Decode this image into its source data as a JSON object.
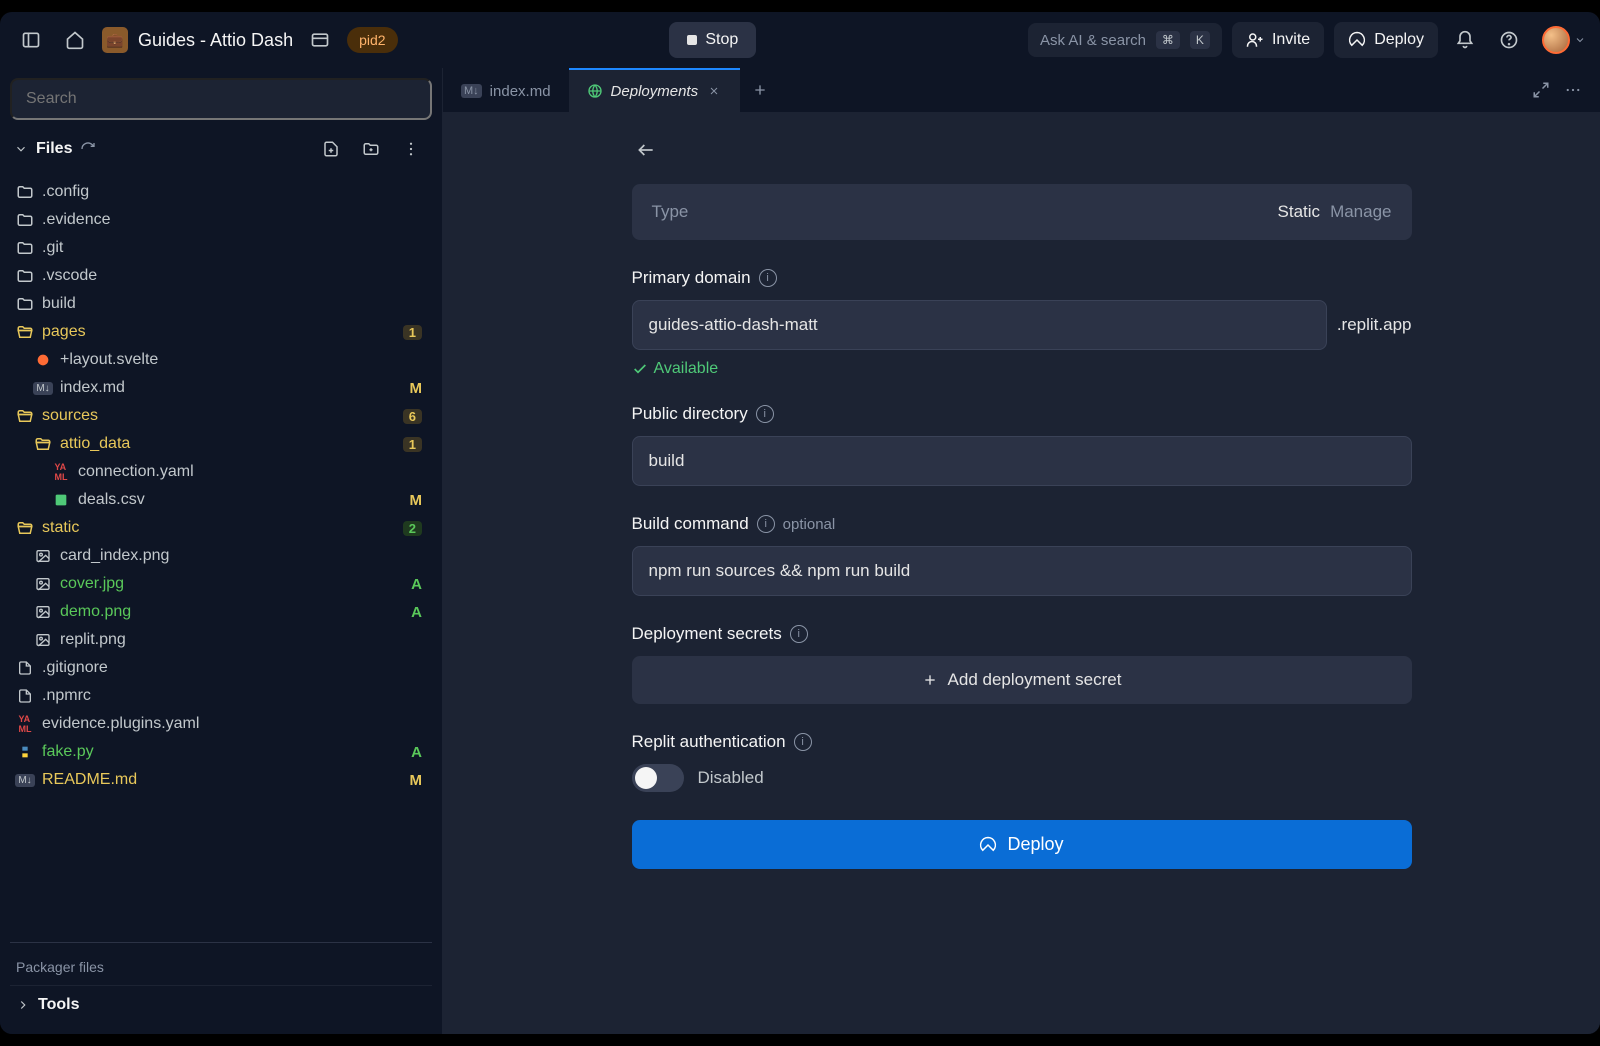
{
  "topbar": {
    "project_title": "Guides - Attio Dash",
    "project_emoji": "💼",
    "pid_label": "pid2",
    "stop_label": "Stop",
    "search_placeholder": "Ask AI & search",
    "search_kbd1": "⌘",
    "search_kbd2": "K",
    "invite_label": "Invite",
    "deploy_label": "Deploy"
  },
  "sidebar": {
    "search_placeholder": "Search",
    "files_label": "Files",
    "packager_label": "Packager files",
    "tools_label": "Tools",
    "tree": [
      {
        "kind": "folder",
        "name": ".config",
        "indent": 0
      },
      {
        "kind": "folder",
        "name": ".evidence",
        "indent": 0
      },
      {
        "kind": "folder",
        "name": ".git",
        "indent": 0
      },
      {
        "kind": "folder",
        "name": ".vscode",
        "indent": 0
      },
      {
        "kind": "folder",
        "name": "build",
        "indent": 0
      },
      {
        "kind": "folder-open",
        "name": "pages",
        "indent": 0,
        "color": "yellow",
        "badge": "1"
      },
      {
        "kind": "svelte",
        "name": "+layout.svelte",
        "indent": 1
      },
      {
        "kind": "md",
        "name": "index.md",
        "indent": 1,
        "status": "M"
      },
      {
        "kind": "folder-open",
        "name": "sources",
        "indent": 0,
        "color": "yellow",
        "badge": "6"
      },
      {
        "kind": "folder-open",
        "name": "attio_data",
        "indent": 1,
        "color": "yellow",
        "badge": "1"
      },
      {
        "kind": "yaml",
        "name": "connection.yaml",
        "indent": 2
      },
      {
        "kind": "csv",
        "name": "deals.csv",
        "indent": 2,
        "status": "M"
      },
      {
        "kind": "folder-open",
        "name": "static",
        "indent": 0,
        "color": "yellow",
        "badge": "2",
        "badgeColor": "green"
      },
      {
        "kind": "image",
        "name": "card_index.png",
        "indent": 1
      },
      {
        "kind": "image",
        "name": "cover.jpg",
        "indent": 1,
        "color": "green",
        "status": "A"
      },
      {
        "kind": "image",
        "name": "demo.png",
        "indent": 1,
        "color": "green",
        "status": "A"
      },
      {
        "kind": "image",
        "name": "replit.png",
        "indent": 1
      },
      {
        "kind": "file",
        "name": ".gitignore",
        "indent": 0
      },
      {
        "kind": "file",
        "name": ".npmrc",
        "indent": 0
      },
      {
        "kind": "yaml",
        "name": "evidence.plugins.yaml",
        "indent": 0
      },
      {
        "kind": "python",
        "name": "fake.py",
        "indent": 0,
        "color": "green",
        "status": "A"
      },
      {
        "kind": "md",
        "name": "README.md",
        "indent": 0,
        "color": "yellow",
        "status": "M"
      }
    ]
  },
  "tabs": {
    "items": [
      {
        "icon": "md",
        "label": "index.md",
        "active": false
      },
      {
        "icon": "deploy",
        "label": "Deployments",
        "active": true,
        "closable": true
      }
    ]
  },
  "deploy": {
    "type_label": "Type",
    "type_value": "Static",
    "manage_label": "Manage",
    "primary_domain_label": "Primary domain",
    "domain_value": "guides-attio-dash-matt",
    "domain_suffix": ".replit.app",
    "available_label": "Available",
    "public_dir_label": "Public directory",
    "public_dir_value": "build",
    "build_cmd_label": "Build command",
    "build_cmd_optional": "optional",
    "build_cmd_value": "npm run sources && npm run build",
    "secrets_label": "Deployment secrets",
    "add_secret_label": "Add deployment secret",
    "auth_label": "Replit authentication",
    "auth_state": "Disabled",
    "deploy_button": "Deploy"
  }
}
